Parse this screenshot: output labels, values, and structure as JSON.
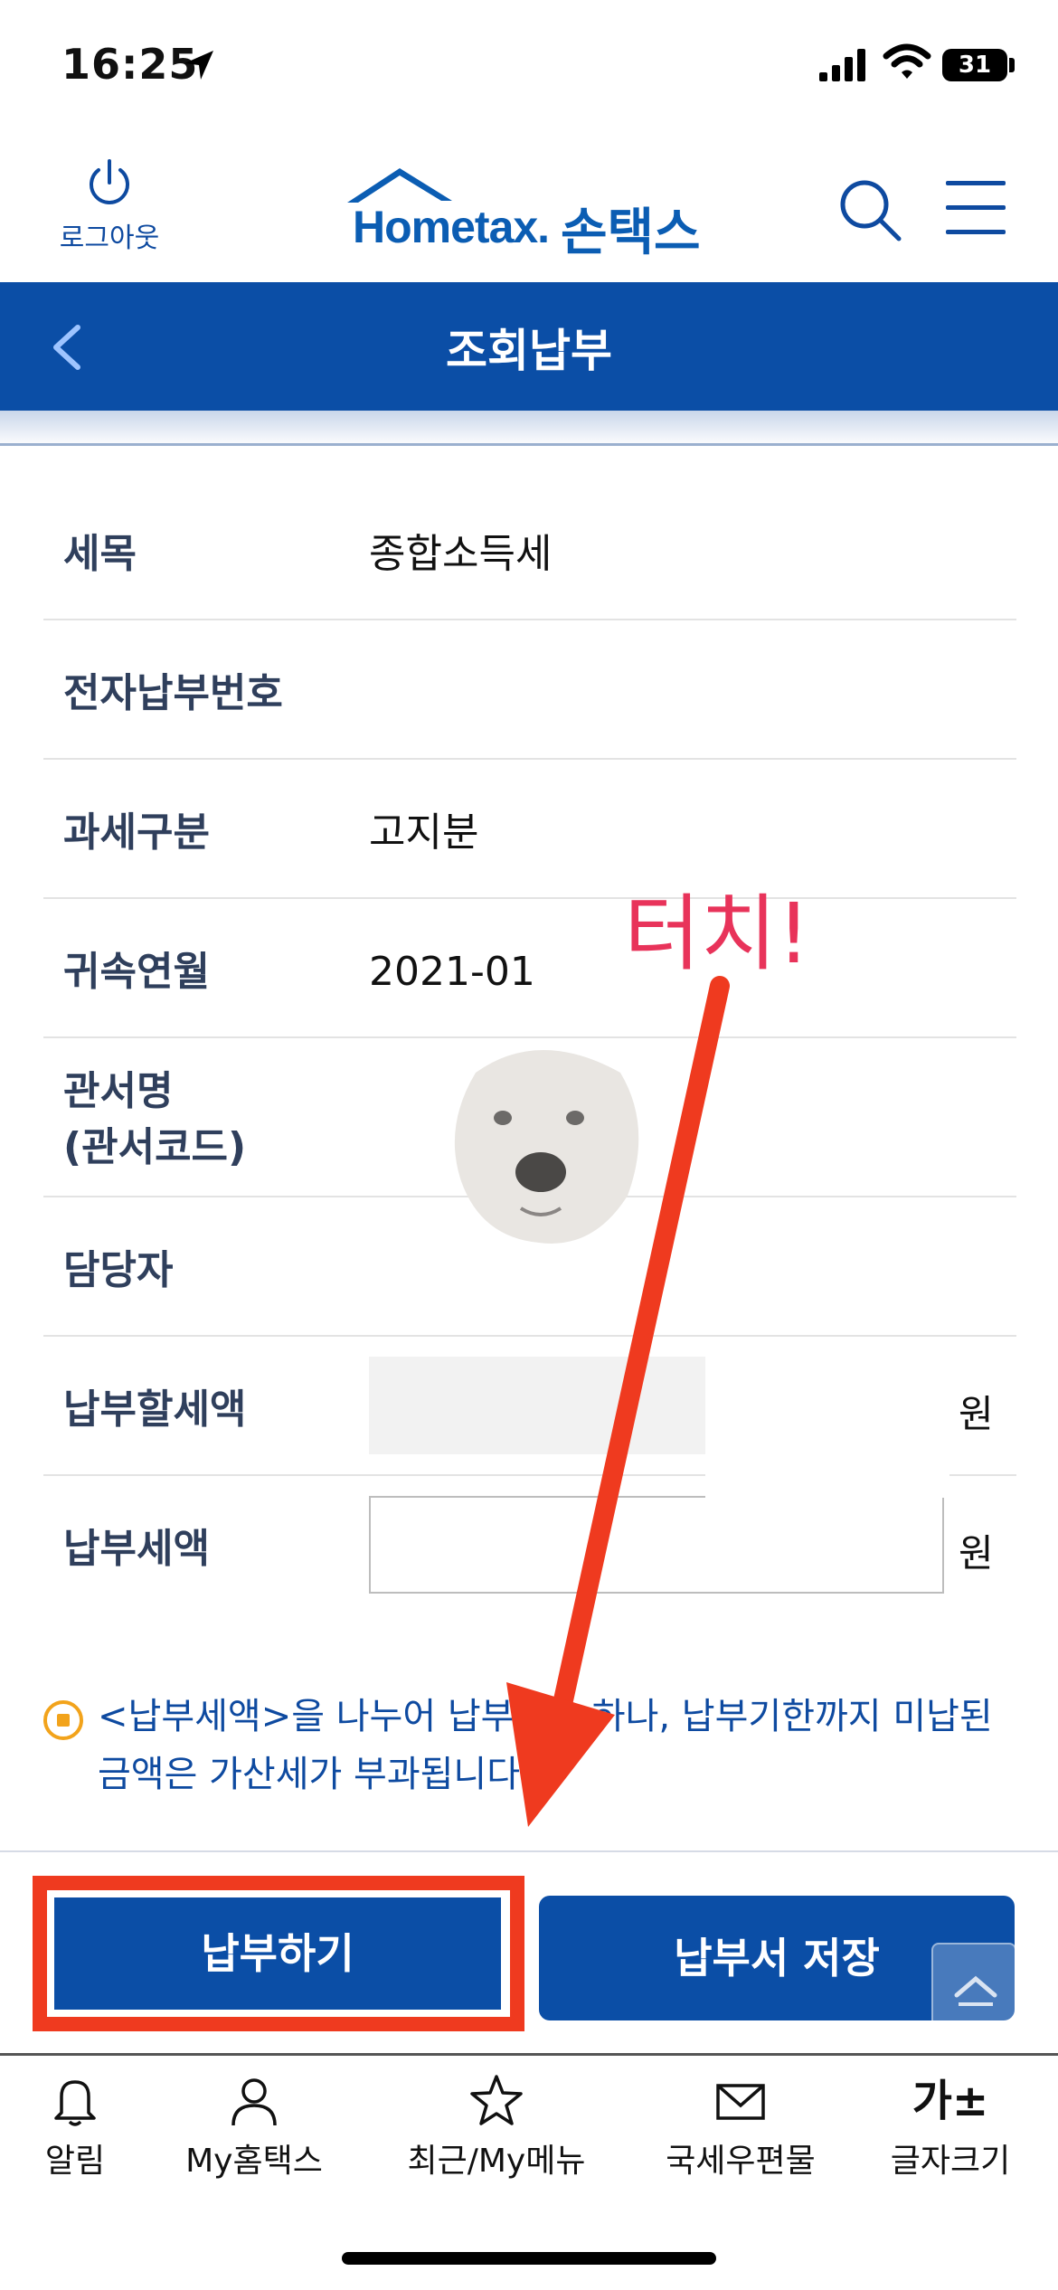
{
  "status_bar": {
    "time": "16:25",
    "battery": "31"
  },
  "header": {
    "logout_label": "로그아웃",
    "logo_text": "Hometax.",
    "logo_kr": "손택스"
  },
  "title_bar": {
    "title": "조회납부"
  },
  "info": {
    "rows": [
      {
        "label": "세목",
        "value": "종합소득세"
      },
      {
        "label": "전자납부번호",
        "value": ""
      },
      {
        "label": "과세구분",
        "value": "고지분"
      },
      {
        "label": "귀속연월",
        "value": "2021-01"
      },
      {
        "label_line1": "관서명",
        "label_line2": "(관서코드)",
        "value": ""
      },
      {
        "label": "담당자",
        "value": ""
      },
      {
        "label": "납부할세액",
        "unit": "원"
      },
      {
        "label": "납부세액",
        "unit": "원",
        "input_value": ""
      }
    ]
  },
  "notice": {
    "text": "<납부세액>을 나누어 납부 가능하나, 납부기한까지 미납된 금액은 가산세가 부과됩니다."
  },
  "actions": {
    "pay_label": "납부하기",
    "save_label": "납부서 저장"
  },
  "tab_bar": {
    "items": [
      {
        "label": "알림",
        "icon": "bell-icon"
      },
      {
        "label": "My홈택스",
        "icon": "person-icon"
      },
      {
        "label": "최근/My메뉴",
        "icon": "star-icon"
      },
      {
        "label": "국세우편물",
        "icon": "mail-icon"
      },
      {
        "label": "글자크기",
        "icon": "font-size-icon",
        "icon_text": "가±"
      }
    ]
  },
  "annotation": {
    "touch_text": "터치!",
    "color": "#ef3a1f"
  },
  "colors": {
    "primary": "#0b4ea6",
    "label": "#2f3f5c",
    "notice": "#0e4aa0",
    "highlight": "#ef3a1f"
  }
}
